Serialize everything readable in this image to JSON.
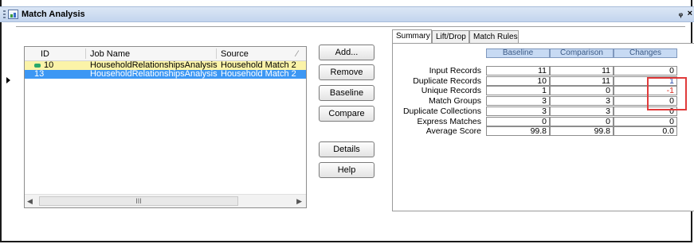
{
  "window": {
    "title": "Match Analysis",
    "pin_label": "ᵩ",
    "close_label": "×"
  },
  "job_list": {
    "columns": [
      "ID",
      "Job Name",
      "Source"
    ],
    "rows": [
      {
        "id": "10",
        "job_name": "HouseholdRelationshipsAnalysis",
        "source": "Household Match 2"
      },
      {
        "id": "13",
        "job_name": "HouseholdRelationshipsAnalysis",
        "source": "Household Match 2"
      }
    ],
    "scroll_thumb_label": "III"
  },
  "buttons": {
    "add": "Add...",
    "remove": "Remove",
    "baseline": "Baseline",
    "compare": "Compare",
    "details": "Details",
    "help": "Help"
  },
  "tabs": [
    "Summary",
    "Lift/Drop",
    "Match Rules"
  ],
  "summary": {
    "columns": [
      "Baseline",
      "Comparison",
      "Changes"
    ],
    "rows": [
      {
        "label": "Input Records",
        "baseline": "11",
        "comparison": "11",
        "changes": "0"
      },
      {
        "label": "Duplicate Records",
        "baseline": "10",
        "comparison": "11",
        "changes": "1"
      },
      {
        "label": "Unique Records",
        "baseline": "1",
        "comparison": "0",
        "changes": "-1"
      },
      {
        "label": "Match Groups",
        "baseline": "3",
        "comparison": "3",
        "changes": "0"
      },
      {
        "label": "Duplicate Collections",
        "baseline": "3",
        "comparison": "3",
        "changes": "0"
      },
      {
        "label": "Express Matches",
        "baseline": "0",
        "comparison": "0",
        "changes": "0"
      },
      {
        "label": "Average Score",
        "baseline": "99.8",
        "comparison": "99.8",
        "changes": "0.0"
      }
    ]
  },
  "colors": {
    "selected_row": "#3c97f4",
    "highlight_row": "#fbf3a8",
    "header_fill": "#c7daf3",
    "annotation_box": "#e03b3b",
    "negative_value": "#d9281c",
    "positive_value": "#2448a8"
  }
}
